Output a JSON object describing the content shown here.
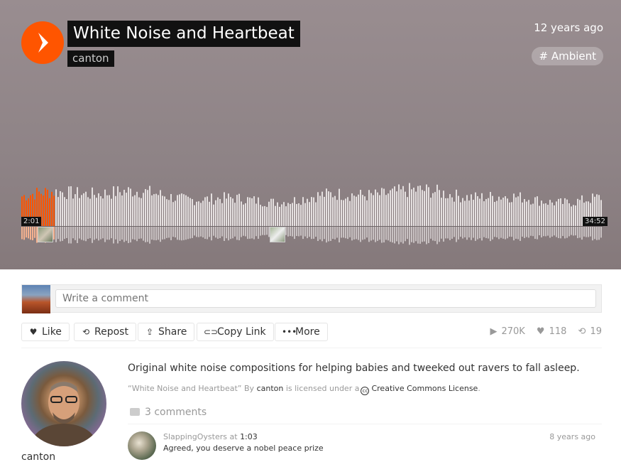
{
  "track": {
    "title": "White Noise and Heartbeat",
    "artist": "canton",
    "posted": "12 years ago",
    "tag": "# Ambient"
  },
  "player": {
    "elapsed": "2:01",
    "duration": "34:52",
    "progress_fraction": 0.058,
    "played_color": "#ff5500",
    "unplayed_color": "#e5e0e0",
    "comment_markers": [
      {
        "time": "1:03",
        "user": "SlappingOysters"
      },
      {
        "time": "",
        "user": ""
      }
    ]
  },
  "comment_box": {
    "placeholder": "Write a comment"
  },
  "actions": {
    "like": "Like",
    "repost": "Repost",
    "share": "Share",
    "copy_link": "Copy Link",
    "more": "More"
  },
  "stats": {
    "plays": "270K",
    "likes": "118",
    "reposts": "19"
  },
  "uploader": {
    "name": "canton"
  },
  "description": "Original white noise compositions for helping babies and tweeked out ravers to fall asleep.",
  "license": {
    "track": "“White Noise and Heartbeat”",
    "by": "By",
    "user": "canton",
    "mid": "is licensed under a",
    "name": "Creative Commons License",
    "end": "."
  },
  "comments": {
    "count_label": "3 comments",
    "items": [
      {
        "user": "SlappingOysters",
        "at": "at",
        "time": "1:03",
        "text": "Agreed, you deserve a nobel peace prize",
        "ago": "8 years ago"
      }
    ]
  },
  "icons": {
    "play": "play-icon",
    "like": "heart-icon",
    "repost": "repost-icon",
    "share": "share-icon",
    "copy_link": "link-icon",
    "more": "more-dots-icon",
    "plays": "play-count-icon",
    "likes": "heart-count-icon",
    "reposts": "repost-count-icon",
    "comments": "comment-bubble-icon"
  },
  "brand_color": "#ff5500"
}
